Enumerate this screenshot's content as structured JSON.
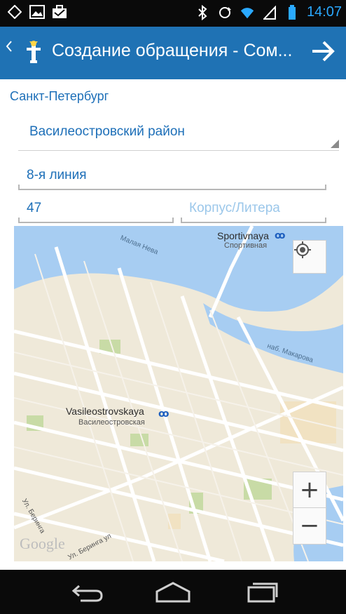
{
  "status_bar": {
    "time": "14:07",
    "left_icons": [
      "circle-notification-icon",
      "image-icon",
      "briefcase-icon"
    ],
    "right_icons": [
      "bluetooth-icon",
      "sync-icon",
      "wifi-icon",
      "signal-icon",
      "battery-icon"
    ]
  },
  "action_bar": {
    "title": "Создание обращения - Сом...",
    "icons": [
      "back-chevron-icon",
      "app-logo-icon",
      "arrow-right-icon"
    ]
  },
  "form": {
    "city": "Санкт-Петербург",
    "district": "Василеостровский район",
    "street": "8-я линия",
    "house": "47",
    "building_placeholder": "Корпус/Литера"
  },
  "map": {
    "labels": {
      "station1": "Sportivnaya",
      "station1_ru": "Спортивная",
      "station2": "Vasileostrovskaya",
      "station2_ru": "Василеостровская",
      "river": "Малая Нева",
      "street_right": "наб. Макарова",
      "street_bottom": "Ул. Беринга",
      "street_bottom2": "Ул. Беринга ул",
      "attribution": "Google"
    },
    "controls": {
      "zoom_in": "+",
      "zoom_out": "−"
    },
    "colors": {
      "water": "#a7cdf2",
      "land": "#efe9d9",
      "park": "#c8dba6",
      "road": "#ffffff"
    }
  },
  "nav_bar": {
    "icons": [
      "back-icon",
      "home-icon",
      "recent-apps-icon"
    ]
  }
}
